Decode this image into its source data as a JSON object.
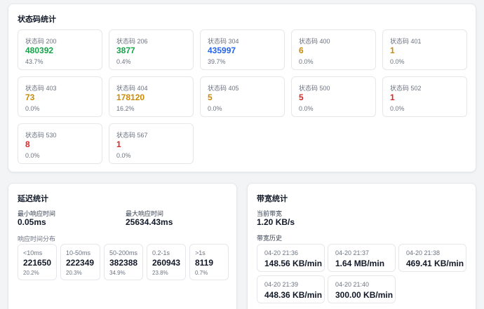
{
  "status_section": {
    "title": "状态码统计",
    "items": [
      {
        "label": "状态码 200",
        "count": "480392",
        "pct": "43.7%",
        "color": "#16a34a"
      },
      {
        "label": "状态码 206",
        "count": "3877",
        "pct": "0.4%",
        "color": "#16a34a"
      },
      {
        "label": "状态码 304",
        "count": "435997",
        "pct": "39.7%",
        "color": "#2563eb"
      },
      {
        "label": "状态码 400",
        "count": "6",
        "pct": "0.0%",
        "color": "#ca8a04"
      },
      {
        "label": "状态码 401",
        "count": "1",
        "pct": "0.0%",
        "color": "#ca8a04"
      },
      {
        "label": "状态码 403",
        "count": "73",
        "pct": "0.0%",
        "color": "#ca8a04"
      },
      {
        "label": "状态码 404",
        "count": "178120",
        "pct": "16.2%",
        "color": "#ca8a04"
      },
      {
        "label": "状态码 405",
        "count": "5",
        "pct": "0.0%",
        "color": "#ca8a04"
      },
      {
        "label": "状态码 500",
        "count": "5",
        "pct": "0.0%",
        "color": "#dc2626"
      },
      {
        "label": "状态码 502",
        "count": "1",
        "pct": "0.0%",
        "color": "#dc2626"
      },
      {
        "label": "状态码 530",
        "count": "8",
        "pct": "0.0%",
        "color": "#dc2626"
      },
      {
        "label": "状态码 567",
        "count": "1",
        "pct": "0.0%",
        "color": "#dc2626"
      }
    ]
  },
  "latency_section": {
    "title": "延迟统计",
    "min_label": "最小响应时间",
    "min_value": "0.05ms",
    "max_label": "最大响应时间",
    "max_value": "25634.43ms",
    "dist_label": "响应时间分布",
    "distribution": [
      {
        "label": "<10ms",
        "count": "221650",
        "pct": "20.2%"
      },
      {
        "label": "10-50ms",
        "count": "222349",
        "pct": "20.3%"
      },
      {
        "label": "50-200ms",
        "count": "382388",
        "pct": "34.9%"
      },
      {
        "label": "0.2-1s",
        "count": "260943",
        "pct": "23.8%"
      },
      {
        "label": ">1s",
        "count": "8119",
        "pct": "0.7%"
      }
    ]
  },
  "bandwidth_section": {
    "title": "带宽统计",
    "current_label": "当前带宽",
    "current_value": "1.20 KB/s",
    "history_label": "带宽历史",
    "history": [
      {
        "time": "04-20 21:36",
        "value": "148.56 KB/min"
      },
      {
        "time": "04-20 21:37",
        "value": "1.64 MB/min"
      },
      {
        "time": "04-20 21:38",
        "value": "469.41 KB/min"
      },
      {
        "time": "04-20 21:39",
        "value": "448.36 KB/min"
      },
      {
        "time": "04-20 21:40",
        "value": "300.00 KB/min"
      }
    ]
  }
}
